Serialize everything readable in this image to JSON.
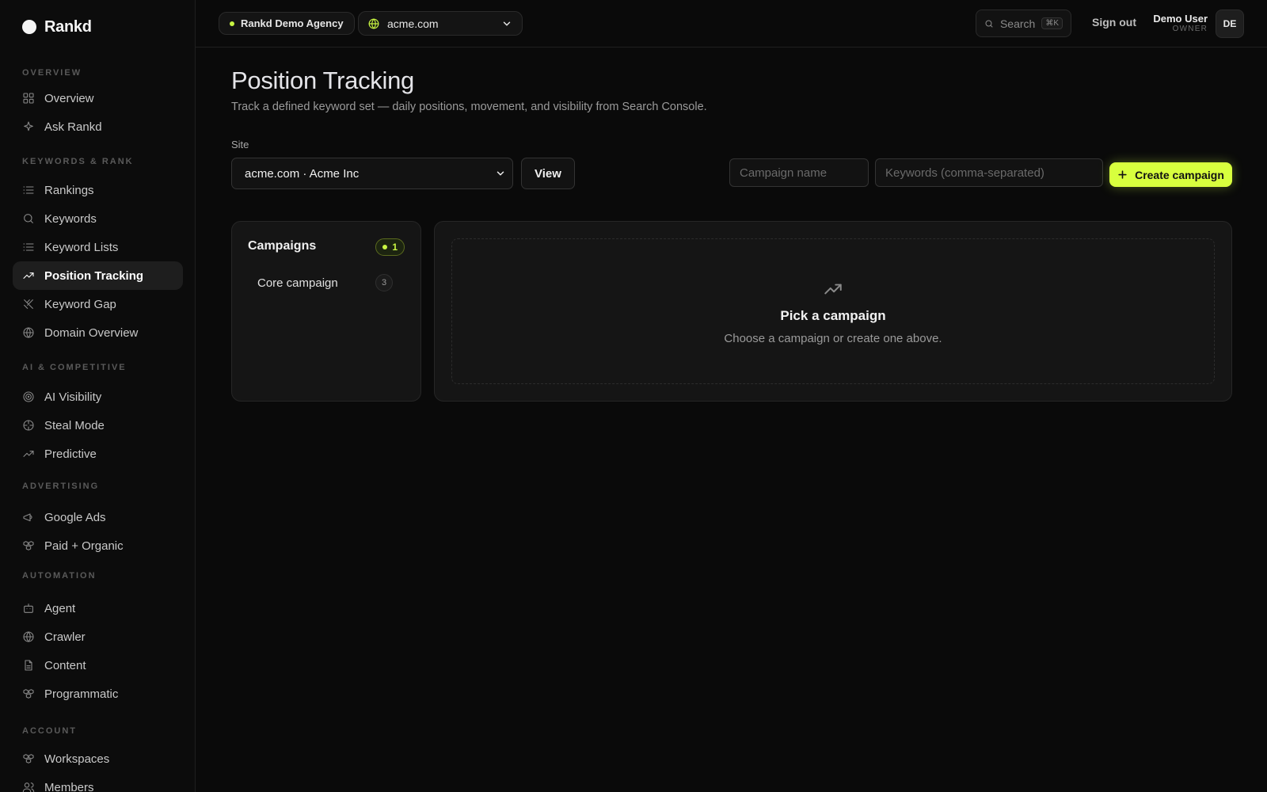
{
  "brand": {
    "name": "Rankd"
  },
  "sidebar": {
    "sections": [
      {
        "label": "OVERVIEW",
        "items": [
          {
            "label": "Overview",
            "icon": "grid-icon"
          },
          {
            "label": "Ask Rankd",
            "icon": "sparkle-icon"
          }
        ]
      },
      {
        "label": "KEYWORDS & RANK",
        "items": [
          {
            "label": "Rankings",
            "icon": "list-icon"
          },
          {
            "label": "Keywords",
            "icon": "search-icon"
          },
          {
            "label": "Keyword Lists",
            "icon": "list-icon"
          },
          {
            "label": "Position Tracking",
            "icon": "trending-up-icon",
            "active": true
          },
          {
            "label": "Keyword Gap",
            "icon": "swords-icon"
          },
          {
            "label": "Domain Overview",
            "icon": "globe-icon"
          }
        ]
      },
      {
        "label": "AI & COMPETITIVE",
        "items": [
          {
            "label": "AI Visibility",
            "icon": "radar-icon"
          },
          {
            "label": "Steal Mode",
            "icon": "crosshair-icon"
          },
          {
            "label": "Predictive",
            "icon": "trending-up-icon"
          }
        ]
      },
      {
        "label": "ADVERTISING",
        "items": [
          {
            "label": "Google Ads",
            "icon": "megaphone-icon"
          },
          {
            "label": "Paid + Organic",
            "icon": "boxes-icon"
          }
        ]
      },
      {
        "label": "AUTOMATION",
        "items": [
          {
            "label": "Agent",
            "icon": "bot-icon"
          },
          {
            "label": "Crawler",
            "icon": "globe-icon"
          },
          {
            "label": "Content",
            "icon": "file-icon"
          },
          {
            "label": "Programmatic",
            "icon": "boxes-icon"
          }
        ]
      },
      {
        "label": "ACCOUNT",
        "items": [
          {
            "label": "Workspaces",
            "icon": "boxes-icon"
          },
          {
            "label": "Members",
            "icon": "users-icon"
          }
        ]
      }
    ]
  },
  "topbar": {
    "agency": "Rankd Demo Agency",
    "site": "acme.com",
    "search_label": "Search",
    "search_kbd": "⌘K",
    "signout": "Sign out",
    "user_name": "Demo User",
    "user_role": "OWNER",
    "avatar_initials": "DE"
  },
  "main": {
    "title": "Position Tracking",
    "subtitle": "Track a defined keyword set — daily positions, movement, and visibility from Search Console.",
    "site_label": "Site",
    "site_value": "acme.com · Acme Inc",
    "view_button": "View",
    "campaign_name_placeholder": "Campaign name",
    "keywords_placeholder": "Keywords (comma-separated)",
    "create_button": "Create campaign"
  },
  "campaigns": {
    "title": "Campaigns",
    "count": "1",
    "items": [
      {
        "name": "Core campaign",
        "count": "3"
      }
    ]
  },
  "empty_state": {
    "title": "Pick a campaign",
    "subtitle": "Choose a campaign or create one above."
  },
  "colors": {
    "accent": "#d8ff3e",
    "background": "#0a0a0a"
  }
}
